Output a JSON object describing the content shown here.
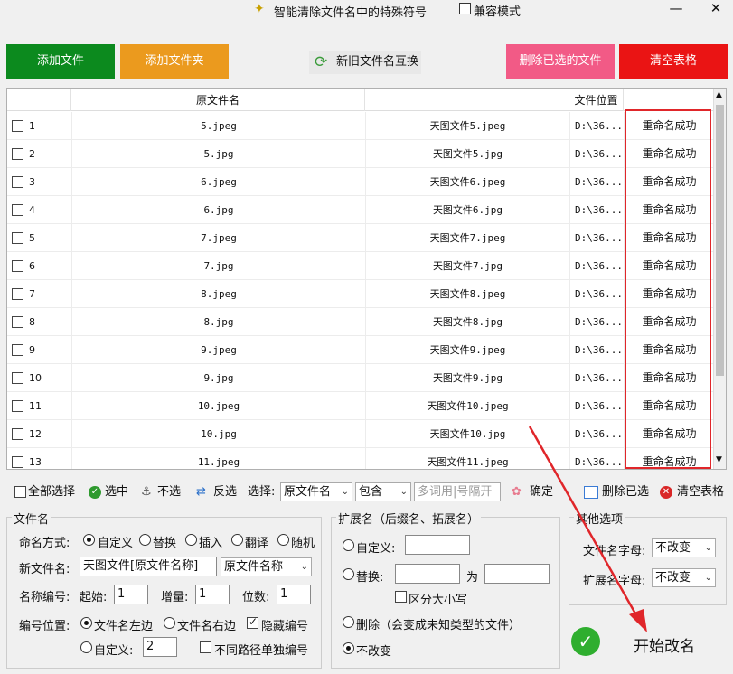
{
  "window": {
    "title": "智能清除文件名中的特殊符号",
    "compat_mode_label": "兼容模式",
    "minimize": "—",
    "close": "✕"
  },
  "top_buttons": {
    "add_file": "添加文件",
    "add_folder": "添加文件夹",
    "swap_names": "新旧文件名互换",
    "delete_selected": "删除已选的文件",
    "clear_table": "清空表格"
  },
  "colors": {
    "green_button": "#0c8a1e",
    "orange_button": "#eb9a1e",
    "pink_button": "#f25a86",
    "red_button": "#ea1414",
    "highlight_border": "#e0262a"
  },
  "table": {
    "headers": [
      "原文件名",
      "",
      "文件位置",
      ""
    ],
    "rows": [
      {
        "num": "1",
        "orig": "5.jpeg",
        "new": "天图文件5.jpeg",
        "path": "D:\\36...",
        "status": "重命名成功"
      },
      {
        "num": "2",
        "orig": "5.jpg",
        "new": "天图文件5.jpg",
        "path": "D:\\36...",
        "status": "重命名成功"
      },
      {
        "num": "3",
        "orig": "6.jpeg",
        "new": "天图文件6.jpeg",
        "path": "D:\\36...",
        "status": "重命名成功"
      },
      {
        "num": "4",
        "orig": "6.jpg",
        "new": "天图文件6.jpg",
        "path": "D:\\36...",
        "status": "重命名成功"
      },
      {
        "num": "5",
        "orig": "7.jpeg",
        "new": "天图文件7.jpeg",
        "path": "D:\\36...",
        "status": "重命名成功"
      },
      {
        "num": "6",
        "orig": "7.jpg",
        "new": "天图文件7.jpg",
        "path": "D:\\36...",
        "status": "重命名成功"
      },
      {
        "num": "7",
        "orig": "8.jpeg",
        "new": "天图文件8.jpeg",
        "path": "D:\\36...",
        "status": "重命名成功"
      },
      {
        "num": "8",
        "orig": "8.jpg",
        "new": "天图文件8.jpg",
        "path": "D:\\36...",
        "status": "重命名成功"
      },
      {
        "num": "9",
        "orig": "9.jpeg",
        "new": "天图文件9.jpeg",
        "path": "D:\\36...",
        "status": "重命名成功"
      },
      {
        "num": "10",
        "orig": "9.jpg",
        "new": "天图文件9.jpg",
        "path": "D:\\36...",
        "status": "重命名成功"
      },
      {
        "num": "11",
        "orig": "10.jpeg",
        "new": "天图文件10.jpeg",
        "path": "D:\\36...",
        "status": "重命名成功"
      },
      {
        "num": "12",
        "orig": "10.jpg",
        "new": "天图文件10.jpg",
        "path": "D:\\36...",
        "status": "重命名成功"
      },
      {
        "num": "13",
        "orig": "11.jpeg",
        "new": "天图文件11.jpeg",
        "path": "D:\\36...",
        "status": "重命名成功"
      }
    ]
  },
  "toolbar": {
    "select_all": "全部选择",
    "select": "选中",
    "deselect": "不选",
    "invert": "反选",
    "choose_label": "选择:",
    "field_select": "原文件名",
    "match_select": "包含",
    "keyword_placeholder": "多词用|号隔开",
    "confirm": "确定",
    "delete_selected": "删除已选",
    "clear_table": "清空表格"
  },
  "filename_panel": {
    "title": "文件名",
    "mode_label": "命名方式:",
    "modes": [
      "自定义",
      "替换",
      "插入",
      "翻译",
      "随机"
    ],
    "new_name_label": "新文件名:",
    "new_name_value": "天图文件[原文件名称]",
    "new_name_select": "原文件名称",
    "numbering_label": "名称编号:",
    "start_label": "起始:",
    "start_value": "1",
    "increment_label": "增量:",
    "increment_value": "1",
    "digits_label": "位数:",
    "digits_value": "1",
    "position_label": "编号位置:",
    "pos_left": "文件名左边",
    "pos_right": "文件名右边",
    "hide_number": "隐藏编号",
    "pos_custom": "自定义:",
    "custom_value": "2",
    "separate_numbering": "不同路径单独编号"
  },
  "ext_panel": {
    "title": "扩展名（后缀名、拓展名）",
    "custom": "自定义:",
    "replace": "替换:",
    "to_label": "为",
    "case_sensitive": "区分大小写",
    "delete": "删除（会变成未知类型的文件）",
    "no_change": "不改变"
  },
  "other_panel": {
    "title": "其他选项",
    "filename_case_label": "文件名字母:",
    "filename_case_value": "不改变",
    "ext_case_label": "扩展名字母:",
    "ext_case_value": "不改变"
  },
  "start": {
    "label": "开始改名"
  }
}
